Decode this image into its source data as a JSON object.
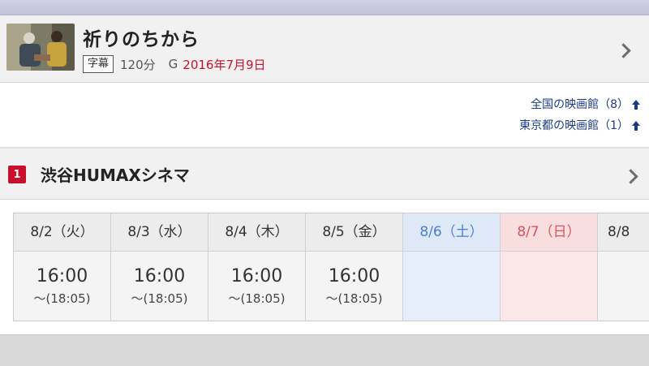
{
  "movie": {
    "title": "祈りのちから",
    "subtitle_badge": "字幕",
    "duration": "120分",
    "rating": "G",
    "release_date": "2016年7月9日"
  },
  "links": [
    {
      "label": "全国の映画館（8）"
    },
    {
      "label": "東京都の映画館（1）"
    }
  ],
  "theater": {
    "rank": "1",
    "name": "渋谷HUMAXシネマ"
  },
  "schedule": [
    {
      "date": "8/2（火）",
      "start": "16:00",
      "end": "〜(18:05)"
    },
    {
      "date": "8/3（水）",
      "start": "16:00",
      "end": "〜(18:05)"
    },
    {
      "date": "8/4（木）",
      "start": "16:00",
      "end": "〜(18:05)"
    },
    {
      "date": "8/5（金）",
      "start": "16:00",
      "end": "〜(18:05)"
    },
    {
      "date": "8/6（土）",
      "start": "",
      "end": ""
    },
    {
      "date": "8/7（日）",
      "start": "",
      "end": ""
    },
    {
      "date": "8/8",
      "start": "",
      "end": ""
    }
  ],
  "colors": {
    "accent_red": "#c8102e",
    "link_blue": "#1b3a86",
    "saturday_blue": "#4a7fd0",
    "sunday_red": "#e0505a"
  },
  "icons": [
    "chevron-right-icon",
    "up-arrow-icon"
  ]
}
